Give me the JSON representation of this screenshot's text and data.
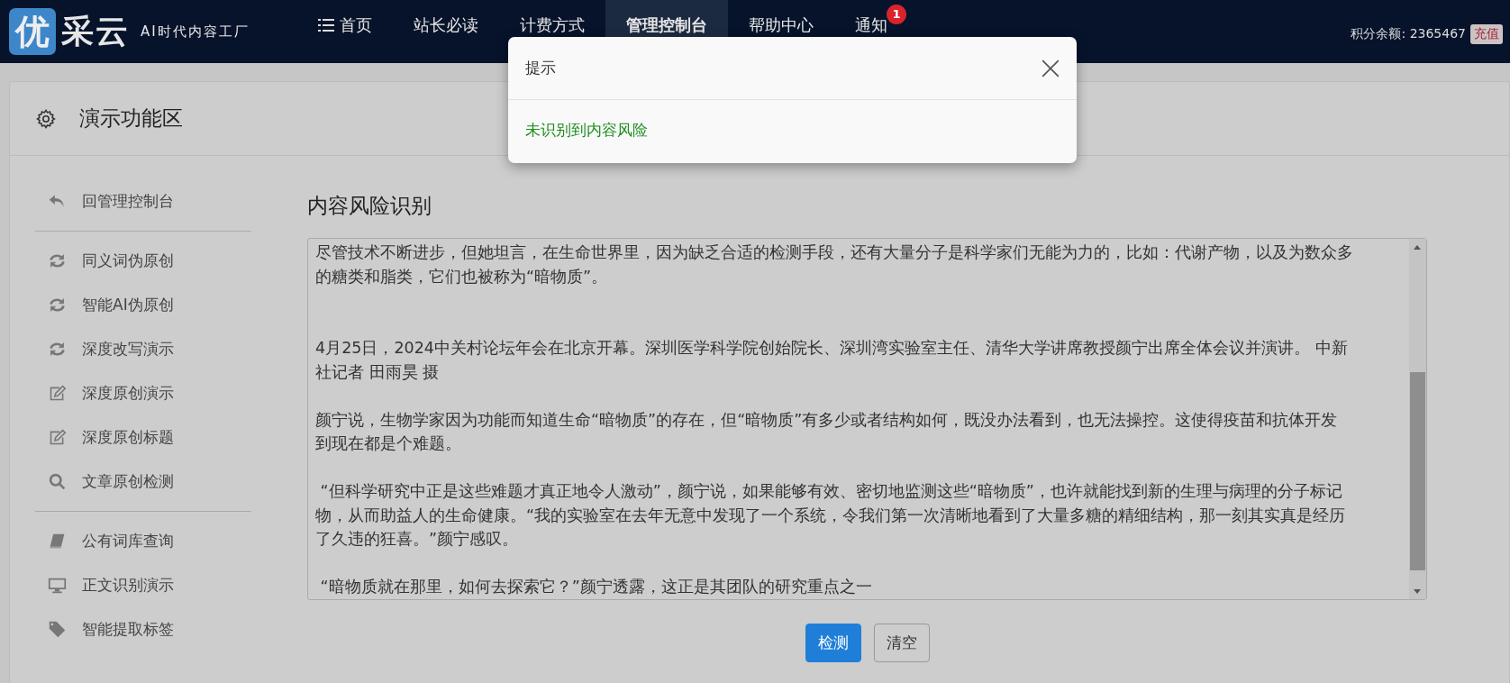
{
  "logo": {
    "mark": "优",
    "name": "采云",
    "slogan": "AI时代内容工厂"
  },
  "nav": [
    {
      "label": "首页",
      "kind": "list",
      "selected": false
    },
    {
      "label": "站长必读",
      "selected": false
    },
    {
      "label": "计费方式",
      "selected": false
    },
    {
      "label": "管理控制台",
      "selected": true
    },
    {
      "label": "帮助中心",
      "selected": false
    },
    {
      "label": "通知",
      "selected": false,
      "badge": "1"
    }
  ],
  "account": {
    "label": "积分余额: 2365467",
    "button": "充值"
  },
  "panel": {
    "title": "演示功能区"
  },
  "sidebar": {
    "groups": [
      [
        {
          "label": "回管理控制台",
          "kind": "reply"
        }
      ],
      [
        {
          "label": "同义词伪原创",
          "kind": "refresh"
        },
        {
          "label": "智能AI伪原创",
          "kind": "refresh"
        },
        {
          "label": "深度改写演示",
          "kind": "refresh"
        },
        {
          "label": "深度原创演示",
          "kind": "edit"
        },
        {
          "label": "深度原创标题",
          "kind": "edit"
        },
        {
          "label": "文章原创检测",
          "kind": "search"
        }
      ],
      [
        {
          "label": "公有词库查询",
          "kind": "book"
        },
        {
          "label": "正文识别演示",
          "kind": "monitor"
        },
        {
          "label": "智能提取标签",
          "kind": "tag"
        }
      ]
    ]
  },
  "content": {
    "title": "内容风险识别",
    "paragraphs": [
      "尽管技术不断进步，但她坦言，在生命世界里，因为缺乏合适的检测手段，还有大量分子是科学家们无能为力的，比如：代谢产物，以及为数众多的糖类和脂类，它们也被称为“暗物质”。",
      "4月25日，2024中关村论坛年会在北京开幕。深圳医学科学院创始院长、深圳湾实验室主任、清华大学讲席教授颜宁出席全体会议并演讲。 中新社记者 田雨昊 摄",
      "颜宁说，生物学家因为功能而知道生命“暗物质”的存在，但“暗物质”有多少或者结构如何，既没办法看到，也无法操控。这使得疫苗和抗体开发到现在都是个难题。",
      " “但科学研究中正是这些难题才真正地令人激动”，颜宁说，如果能够有效、密切地监测这些“暗物质”，也许就能找到新的生理与病理的分子标记物，从而助益人的生命健康。“我的实验室在去年无意中发现了一个系统，令我们第一次清晰地看到了大量多糖的精细结构，那一刻其实真是经历了久违的狂喜。”颜宁感叹。",
      " “暗物质就在那里，如何去探索它？”颜宁透露，这正是其团队的研究重点之一"
    ],
    "buttons": [
      {
        "label": "检测",
        "primary": true
      },
      {
        "label": "清空",
        "primary": false
      }
    ]
  },
  "dialog": {
    "title": "提示",
    "message": "未识别到内容风险"
  }
}
